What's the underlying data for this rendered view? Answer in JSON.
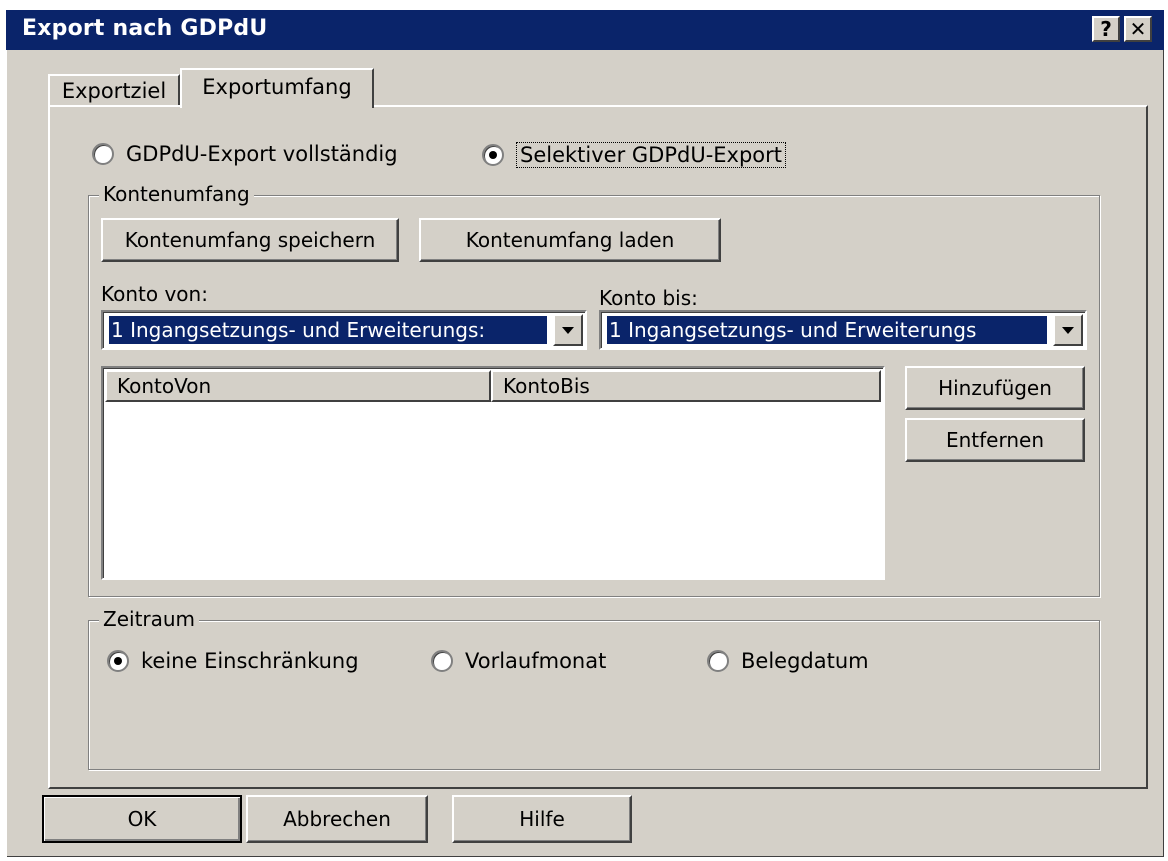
{
  "window": {
    "title": "Export nach GDPdU",
    "help_button": "?",
    "close_button": "✕"
  },
  "tabs": [
    {
      "label": "Exportziel",
      "selected": false
    },
    {
      "label": "Exportumfang",
      "selected": true
    }
  ],
  "export_mode": {
    "full_label": "GDPdU-Export vollständig",
    "selective_label": "Selektiver GDPdU-Export",
    "selected": "selective"
  },
  "kontenumfang": {
    "legend": "Kontenumfang",
    "save_button": "Kontenumfang speichern",
    "load_button": "Kontenumfang laden",
    "konto_von_label": "Konto von:",
    "konto_von_value": "1 Ingangsetzungs- und Erweiterungs:",
    "konto_bis_label": "Konto bis:",
    "konto_bis_value": "1 Ingangsetzungs- und Erweiterungs",
    "columns": [
      "KontoVon",
      "KontoBis"
    ],
    "rows": [],
    "add_button": "Hinzufügen",
    "remove_button": "Entfernen"
  },
  "zeitraum": {
    "legend": "Zeitraum",
    "options": [
      "keine Einschränkung",
      "Vorlaufmonat",
      "Belegdatum"
    ],
    "selected_index": 0
  },
  "footer": {
    "ok_button": "OK",
    "cancel_button": "Abbrechen",
    "help_button": "Hilfe"
  },
  "colors": {
    "titlebar": "#0a246a",
    "face": "#d4d0c8",
    "selection": "#0a246a"
  }
}
